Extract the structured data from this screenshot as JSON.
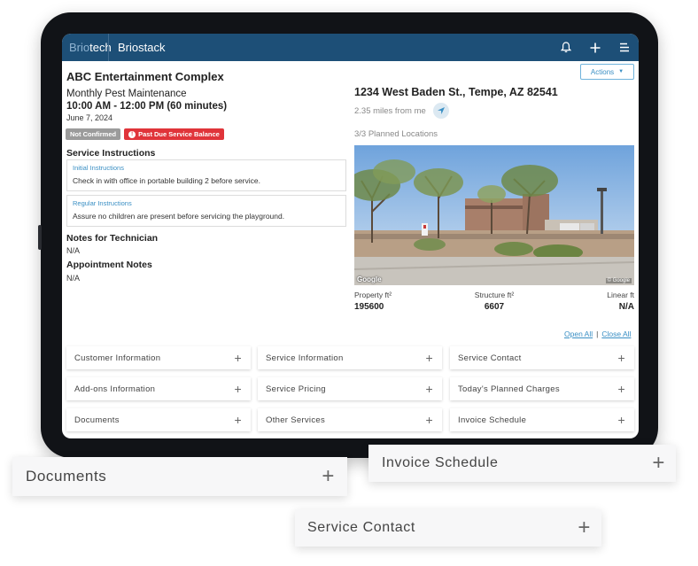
{
  "app": {
    "logo_dim": "Brio",
    "logo_bright": "tech",
    "title": "Briostack"
  },
  "topbar_icons": [
    "bell-icon",
    "plus-icon",
    "menu-icon"
  ],
  "appointment": {
    "company": "ABC Entertainment Complex",
    "service": "Monthly Pest Maintenance",
    "time": "10:00 AM - 12:00 PM (60 minutes)",
    "date": "June 7, 2024",
    "badges": {
      "not_confirmed": "Not Confirmed",
      "past_due": "Past Due Service Balance"
    }
  },
  "service_instructions": {
    "heading": "Service Instructions",
    "initial": {
      "title": "Initial Instructions",
      "body": "Check in with office in portable building 2 before service."
    },
    "regular": {
      "title": "Regular Instructions",
      "body": "Assure no children are present before servicing the playground."
    }
  },
  "notes": {
    "technician_heading": "Notes for Technician",
    "technician_value": "N/A",
    "appointment_heading": "Appointment Notes",
    "appointment_value": "N/A"
  },
  "actions_label": "Actions",
  "location": {
    "address": "1234 West Baden St., Tempe, AZ 82541",
    "distance": "2.35 miles from me",
    "planned": "3/3 Planned Locations",
    "photo_credit_left": "Google",
    "photo_credit_right": "© Google"
  },
  "stats": {
    "property_label": "Property ft²",
    "property_value": "195600",
    "structure_label": "Structure ft²",
    "structure_value": "6607",
    "linear_label": "Linear ft",
    "linear_value": "N/A"
  },
  "links": {
    "open_all": "Open All",
    "separator": "|",
    "close_all": "Close All"
  },
  "accordions": [
    "Customer Information",
    "Service Information",
    "Service Contact",
    "Add-ons Information",
    "Service Pricing",
    "Today's Planned Charges",
    "Documents",
    "Other Services",
    "Invoice Schedule"
  ],
  "floating_cards": {
    "documents": "Documents",
    "invoice_schedule": "Invoice Schedule",
    "service_contact": "Service Contact"
  },
  "colors": {
    "topbar": "#1d4f77",
    "accent": "#3a8fc4",
    "danger": "#e0343a",
    "badge_grey": "#9b9b9b"
  }
}
